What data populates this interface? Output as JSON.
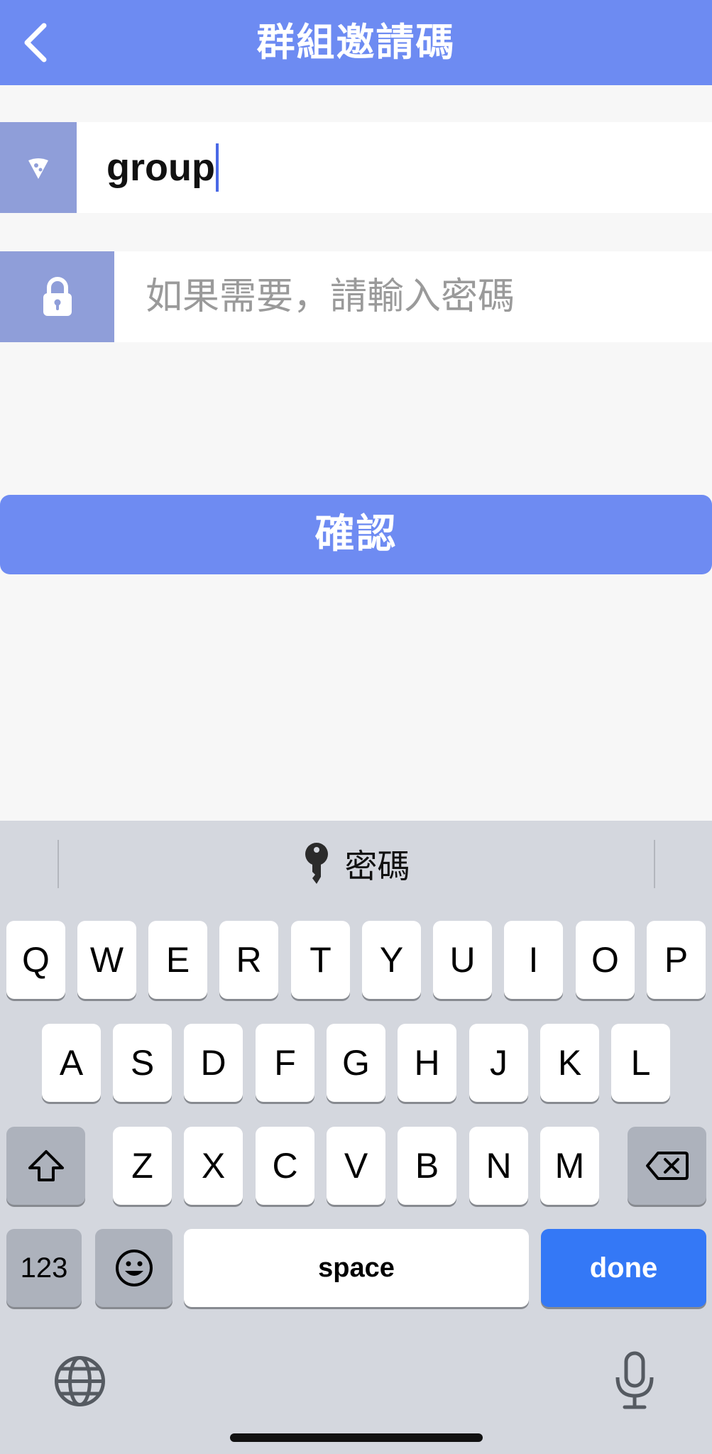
{
  "header": {
    "title": "群組邀請碼",
    "back_icon": "chevron-left-icon"
  },
  "group_field": {
    "value": "group",
    "icon": "pizza-slice-icon"
  },
  "password_field": {
    "placeholder": "如果需要，請輸入密碼",
    "icon": "lock-icon"
  },
  "confirm_button": {
    "label": "確認"
  },
  "keyboard": {
    "suggestion": {
      "icon": "key-icon",
      "label": "密碼"
    },
    "row1": [
      "Q",
      "W",
      "E",
      "R",
      "T",
      "Y",
      "U",
      "I",
      "O",
      "P"
    ],
    "row2": [
      "A",
      "S",
      "D",
      "F",
      "G",
      "H",
      "J",
      "K",
      "L"
    ],
    "row3": [
      "Z",
      "X",
      "C",
      "V",
      "B",
      "N",
      "M"
    ],
    "numbers_key": "123",
    "space_key": "space",
    "done_key": "done"
  },
  "colors": {
    "accent": "#6d8bf2",
    "icon_bg": "#8f9ed9",
    "done_blue": "#3478f6"
  }
}
